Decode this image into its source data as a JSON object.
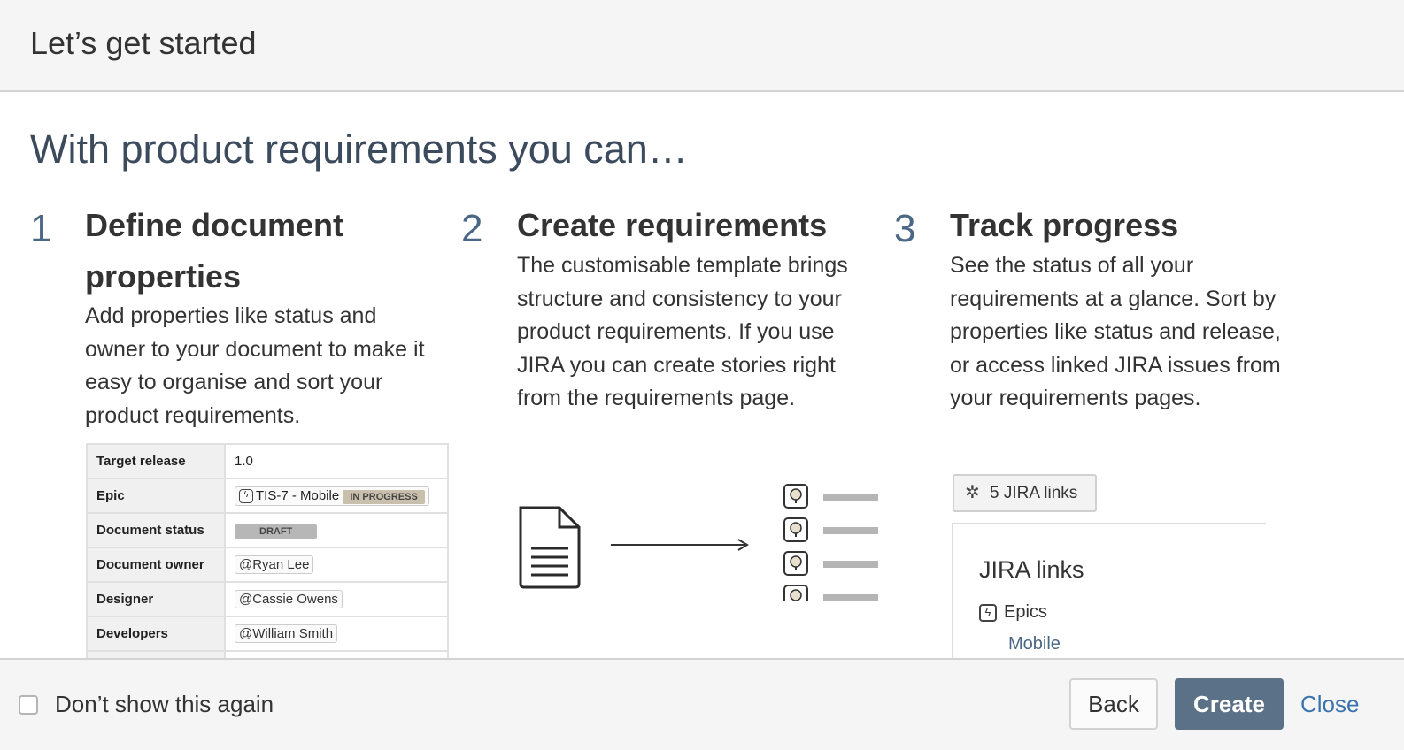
{
  "header": {
    "title": "Let’s get started"
  },
  "main": {
    "heading": "With product requirements you can…",
    "columns": [
      {
        "number": "1",
        "title_line1": "Define document",
        "title_line2": "properties",
        "text": [
          "Add properties like status and",
          "owner to your document to make it",
          "easy to organise and sort your",
          "product requirements."
        ]
      },
      {
        "number": "2",
        "title_line1": "Create requirements",
        "text": [
          "The customisable template brings",
          "structure and consistency to your",
          "product requirements. If you use",
          "JIRA you can create stories right",
          "from the requirements page."
        ]
      },
      {
        "number": "3",
        "title_line1": "Track progress",
        "text": [
          "See the status of all your",
          "requirements at a glance. Sort by",
          "properties like status and release,",
          "or access linked JIRA issues from",
          "your requirements pages."
        ]
      }
    ]
  },
  "properties_table": {
    "rows": [
      {
        "key": "Target release",
        "value": "1.0"
      },
      {
        "key": "Epic",
        "value": "TIS-7 - Mobile",
        "badge": "IN PROGRESS"
      },
      {
        "key": "Document status",
        "badge": "DRAFT"
      },
      {
        "key": "Document owner",
        "value": "@Ryan Lee"
      },
      {
        "key": "Designer",
        "value": "@Cassie Owens"
      },
      {
        "key": "Developers",
        "value": "@William Smith"
      }
    ]
  },
  "jira": {
    "button_label": "5 JIRA links",
    "panel_title": "JIRA links",
    "epics_label": "Epics",
    "epic_item": "Mobile"
  },
  "footer": {
    "checkbox_label": "Don’t show this again",
    "back_label": "Back",
    "create_label": "Create",
    "close_label": "Close"
  },
  "colors": {
    "primary_button": "#5b7187",
    "link": "#3b73af",
    "number": "#4a6785"
  }
}
